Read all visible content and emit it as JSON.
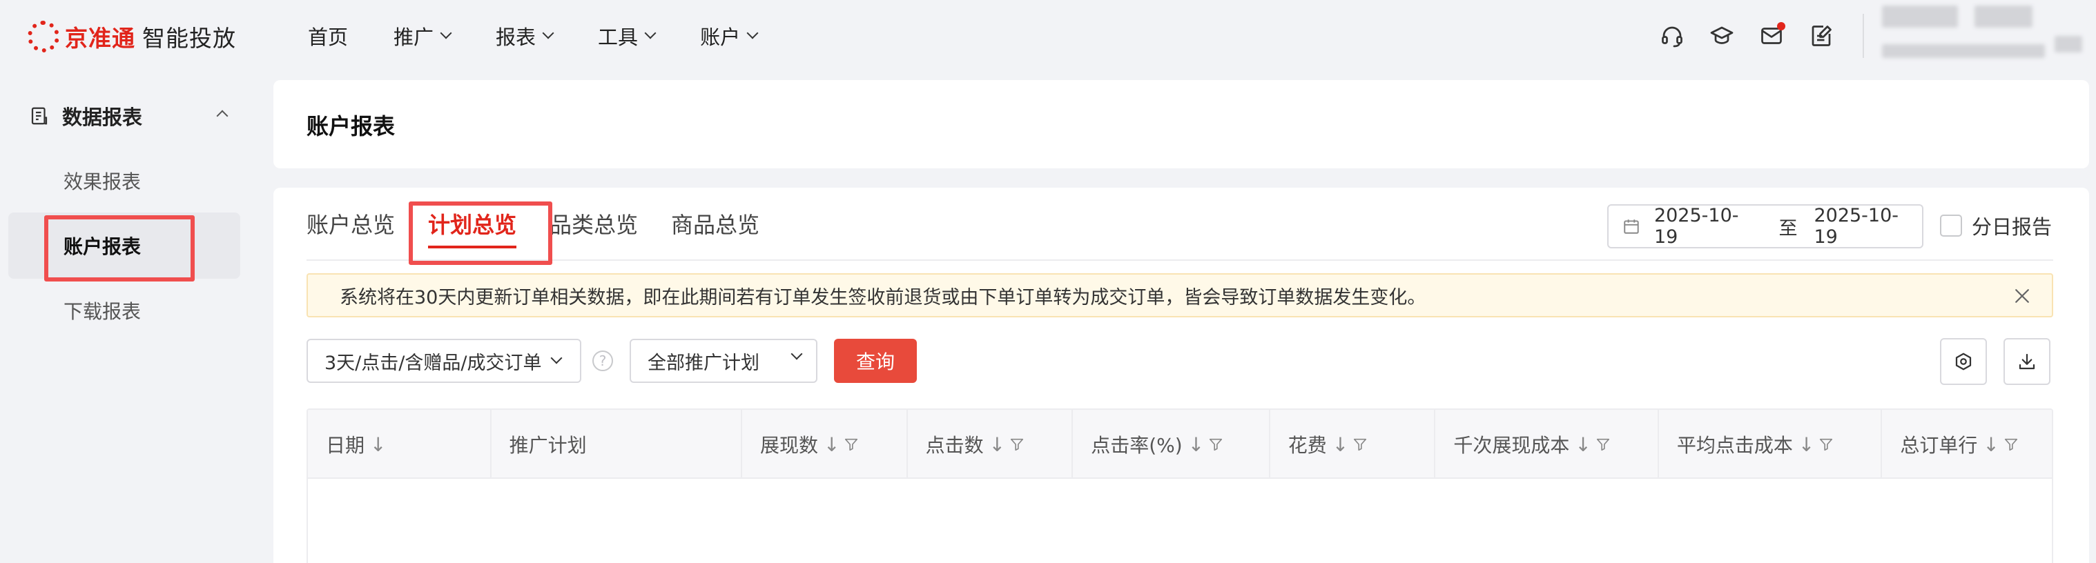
{
  "brand": {
    "name": "京准通",
    "subtitle": "智能投放",
    "accent_color": "#e1251b"
  },
  "nav": {
    "items": [
      {
        "label": "首页",
        "has_dropdown": false
      },
      {
        "label": "推广",
        "has_dropdown": true
      },
      {
        "label": "报表",
        "has_dropdown": true
      },
      {
        "label": "工具",
        "has_dropdown": true
      },
      {
        "label": "账户",
        "has_dropdown": true
      }
    ],
    "icons": [
      "headset-icon",
      "graduation-cap-icon",
      "mail-icon",
      "edit-note-icon"
    ]
  },
  "sidebar": {
    "group_label": "数据报表",
    "group_icon": "report-icon",
    "items": [
      {
        "label": "效果报表",
        "active": false
      },
      {
        "label": "账户报表",
        "active": true
      },
      {
        "label": "下载报表",
        "active": false
      }
    ]
  },
  "header": {
    "title": "账户报表"
  },
  "tabs": [
    {
      "label": "账户总览",
      "active": false
    },
    {
      "label": "计划总览",
      "active": true
    },
    {
      "label": "品类总览",
      "active": false
    },
    {
      "label": "商品总览",
      "active": false
    }
  ],
  "date_range": {
    "start": "2025-10-19",
    "separator": "至",
    "end": "2025-10-19"
  },
  "daily_report": {
    "label": "分日报告",
    "checked": false
  },
  "notice": {
    "text": "系统将在30天内更新订单相关数据，即在此期间若有订单发生签收前退货或由下单订单转为成交订单，皆会导致订单数据发生变化。"
  },
  "filters": {
    "attribution": "3天/点击/含赠品/成交订单",
    "plan": "全部推广计划",
    "query_label": "查询"
  },
  "table": {
    "columns": [
      {
        "label": "日期",
        "sortable": true,
        "filterable": false
      },
      {
        "label": "推广计划",
        "sortable": false,
        "filterable": false
      },
      {
        "label": "展现数",
        "sortable": true,
        "filterable": true
      },
      {
        "label": "点击数",
        "sortable": true,
        "filterable": true
      },
      {
        "label": "点击率(%)",
        "sortable": true,
        "filterable": true
      },
      {
        "label": "花费",
        "sortable": true,
        "filterable": true
      },
      {
        "label": "千次展现成本",
        "sortable": true,
        "filterable": true
      },
      {
        "label": "平均点击成本",
        "sortable": true,
        "filterable": true
      },
      {
        "label": "总订单行",
        "sortable": true,
        "filterable": true
      }
    ],
    "rows": []
  }
}
